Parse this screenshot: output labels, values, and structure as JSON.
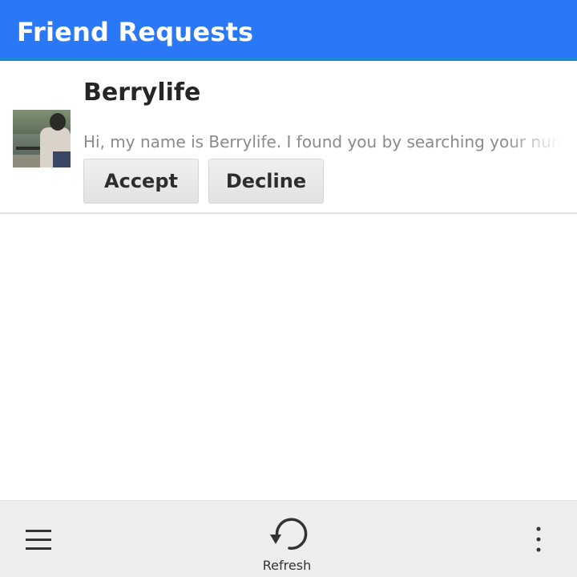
{
  "header": {
    "title": "Friend Requests"
  },
  "requests": [
    {
      "name": "Berrylife",
      "message": "Hi, my name is Berrylife. I found you by searching your num",
      "accept_label": "Accept",
      "decline_label": "Decline"
    }
  ],
  "action_bar": {
    "menu_icon": "hamburger-menu-icon",
    "refresh_icon": "refresh-icon",
    "refresh_label": "Refresh",
    "overflow_icon": "overflow-menu-icon"
  },
  "colors": {
    "title_bar": "#2a78f6",
    "title_accent_line": "#1a8bd1",
    "action_bar": "#eeeeee",
    "button_bg": "#e8e8e8",
    "message_text": "#8a8a8a"
  }
}
